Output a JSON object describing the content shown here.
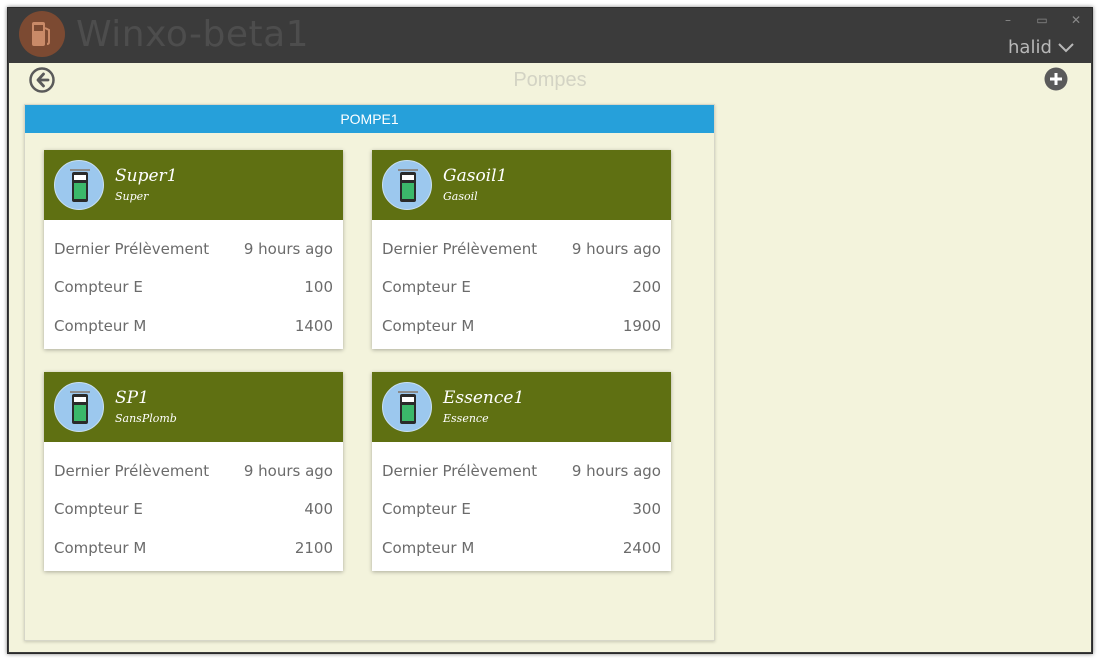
{
  "window": {
    "app_title": "Winxo-beta1",
    "user_name": "halid",
    "controls": {
      "minimize": "–",
      "maximize": "▭",
      "close": "✕"
    }
  },
  "page": {
    "title": "Pompes",
    "icons": {
      "back": "arrow-left-circle-icon",
      "add": "plus-circle-icon"
    }
  },
  "panel": {
    "header": "POMPE1"
  },
  "cards": [
    {
      "name": "Super1",
      "type": "Super",
      "rows": [
        {
          "label": "Dernier Prélèvement",
          "value": "9 hours ago"
        },
        {
          "label": "Compteur E",
          "value": "100"
        },
        {
          "label": "Compteur M",
          "value": "1400"
        }
      ]
    },
    {
      "name": "Gasoil1",
      "type": "Gasoil",
      "rows": [
        {
          "label": "Dernier Prélèvement",
          "value": "9 hours ago"
        },
        {
          "label": "Compteur E",
          "value": "200"
        },
        {
          "label": "Compteur M",
          "value": "1900"
        }
      ]
    },
    {
      "name": "SP1",
      "type": "SansPlomb",
      "rows": [
        {
          "label": "Dernier Prélèvement",
          "value": "9 hours ago"
        },
        {
          "label": "Compteur E",
          "value": "400"
        },
        {
          "label": "Compteur M",
          "value": "2100"
        }
      ]
    },
    {
      "name": "Essence1",
      "type": "Essence",
      "rows": [
        {
          "label": "Dernier Prélèvement",
          "value": "9 hours ago"
        },
        {
          "label": "Compteur E",
          "value": "300"
        },
        {
          "label": "Compteur M",
          "value": "2400"
        }
      ]
    }
  ],
  "colors": {
    "card_header": "#5f7012",
    "panel_header": "#26a0da",
    "content_bg": "#f3f3dc",
    "titlebar_bg": "#3b3b3b"
  }
}
